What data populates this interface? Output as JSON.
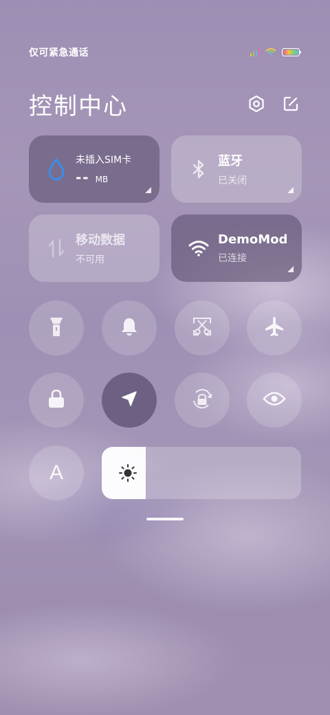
{
  "status_bar": {
    "carrier_text": "仅可紧急通话",
    "icons": [
      "signal-icon",
      "wifi-icon",
      "battery-icon"
    ]
  },
  "header": {
    "title": "控制中心",
    "actions": [
      "settings-icon",
      "edit-icon"
    ]
  },
  "tiles": {
    "data_usage": {
      "label": "未插入SIM卡",
      "value": "--",
      "unit": "MB",
      "icon": "water-drop-icon"
    },
    "bluetooth": {
      "label": "蓝牙",
      "status": "已关闭",
      "icon": "bluetooth-icon"
    },
    "mobile_data": {
      "label": "移动数据",
      "status": "不可用",
      "icon": "data-arrows-icon"
    },
    "wifi": {
      "label": "DemoMod",
      "status": "已连接",
      "icon": "wifi-icon"
    }
  },
  "toggles": [
    {
      "name": "flashlight",
      "icon": "flashlight-icon",
      "active": false
    },
    {
      "name": "bell",
      "icon": "bell-icon",
      "active": false
    },
    {
      "name": "screenshot",
      "icon": "scissors-icon",
      "active": false
    },
    {
      "name": "airplane",
      "icon": "airplane-icon",
      "active": false
    },
    {
      "name": "lock",
      "icon": "lock-icon",
      "active": false
    },
    {
      "name": "location",
      "icon": "location-arrow-icon",
      "active": true
    },
    {
      "name": "rotation-lock",
      "icon": "rotation-lock-icon",
      "active": false
    },
    {
      "name": "eye-comfort",
      "icon": "eye-icon",
      "active": false
    },
    {
      "name": "font-size",
      "icon": "font-a-icon",
      "label": "A",
      "active": false
    }
  ],
  "brightness": {
    "level_fraction": 0.22,
    "icon": "sun-icon"
  },
  "colors": {
    "accent": "#3b8ee8",
    "active_tile": "#5f5273"
  }
}
